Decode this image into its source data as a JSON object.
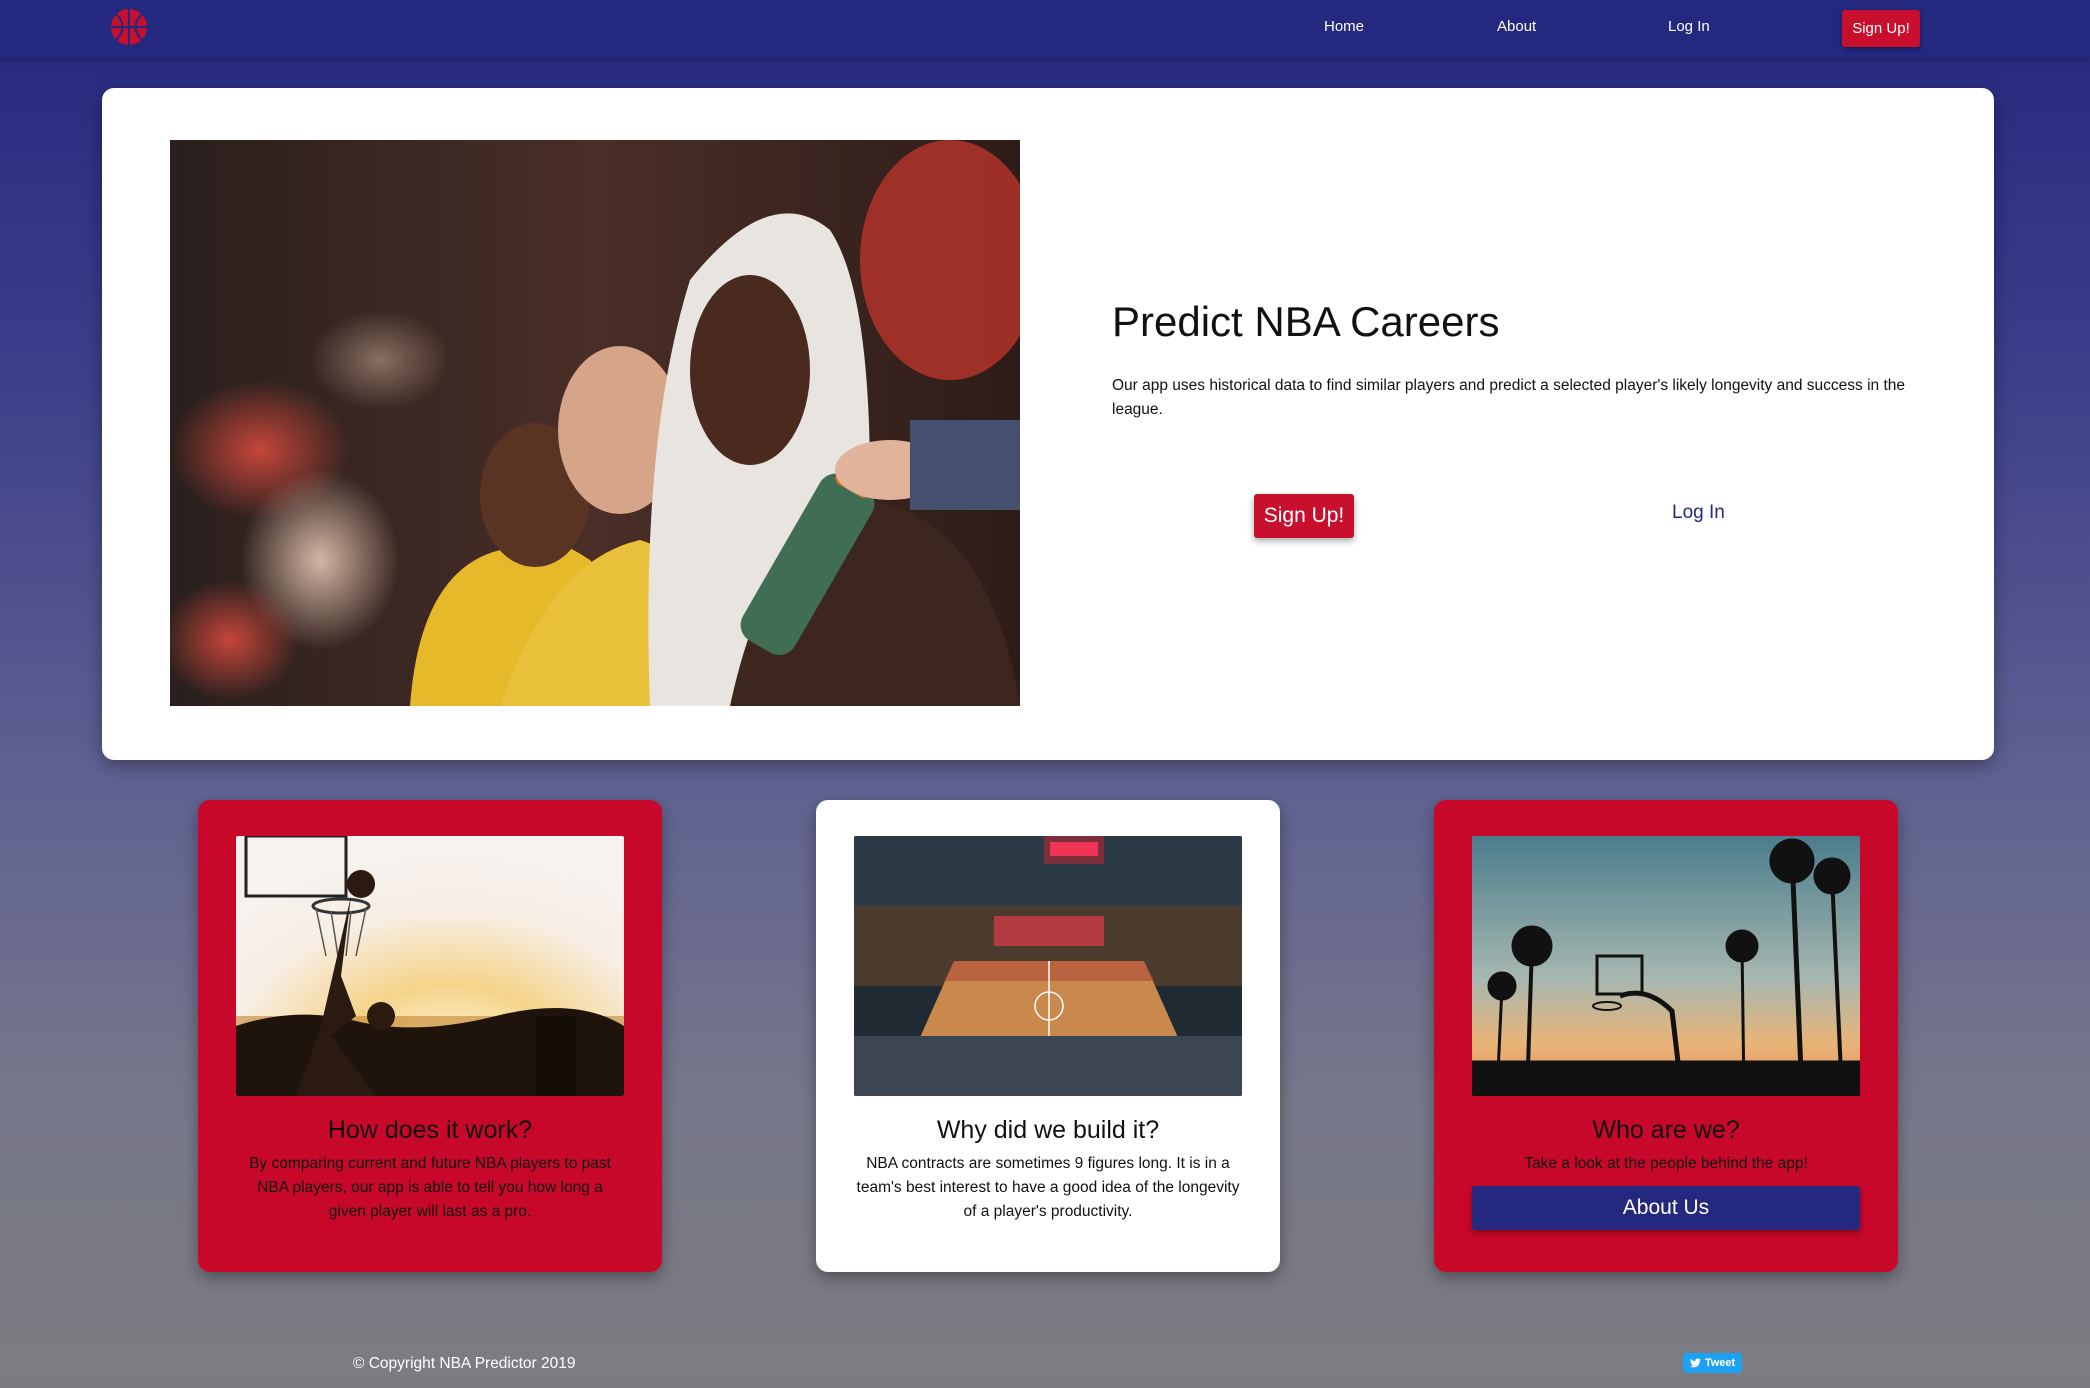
{
  "nav": {
    "logo_icon": "basketball-icon",
    "links": [
      {
        "label": "Home"
      },
      {
        "label": "About"
      },
      {
        "label": "Log In"
      }
    ],
    "signup_label": "Sign Up!"
  },
  "hero": {
    "image": "basketball-players-on-bench-photo",
    "title": "Predict NBA Careers",
    "description": "Our app uses historical data to find similar players and predict a selected player's likely longevity and success in the league.",
    "signup_label": "Sign Up!",
    "login_label": "Log In"
  },
  "cards": [
    {
      "image": "player-dunking-at-sunset-photo",
      "title": "How does it work?",
      "body": "By comparing current and future NBA players to past NBA players, our app is able to tell you how long a given player will last as a pro."
    },
    {
      "image": "nba-arena-crowd-photo",
      "title": "Why did we build it?",
      "body": "NBA contracts are sometimes 9 figures long. It is in a team's best interest to have a good idea of the longevity of a player's productivity."
    },
    {
      "image": "hoop-and-palm-trees-photo",
      "title": "Who are we?",
      "body": "Take a look at the people behind the app!",
      "button_label": "About Us"
    }
  ],
  "footer": {
    "copyright": "© Copyright NBA Predictor 2019",
    "tweet_label": "Tweet",
    "tweet_icon": "twitter-bird-icon"
  },
  "colors": {
    "nav_bg": "#24287f",
    "accent_red": "#c8102e",
    "card_red": "#c8082a",
    "white": "#ffffff"
  }
}
